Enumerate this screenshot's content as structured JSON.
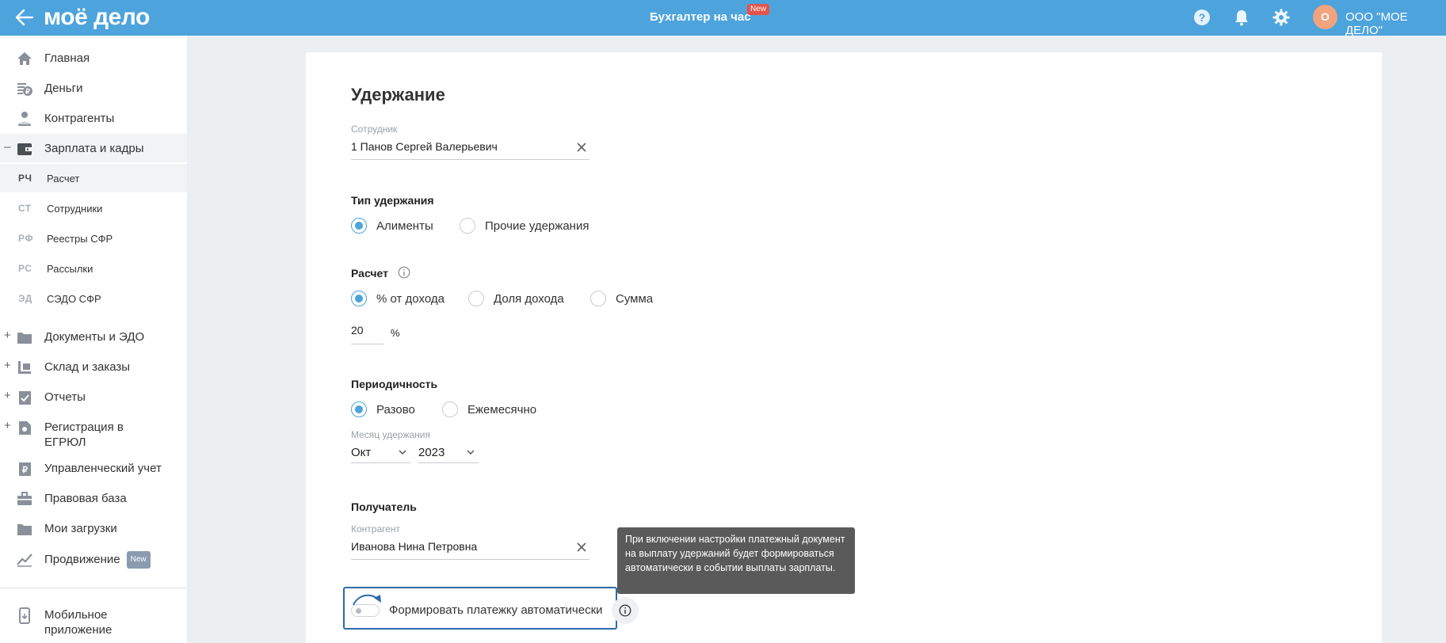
{
  "topbar": {
    "logo": "моё дело",
    "center_title": "Бухгалтер на час",
    "center_badge": "New",
    "avatar_initial": "О",
    "org_name": "ООО \"МОЕ ДЕЛО\"",
    "icons": [
      "back-arrow-icon",
      "help-icon",
      "bell-icon",
      "gear-icon"
    ],
    "accent_color": "#4da3dc"
  },
  "sidebar": {
    "items": [
      {
        "label": "Главная",
        "icon": "home-icon"
      },
      {
        "label": "Деньги",
        "icon": "money-icon"
      },
      {
        "label": "Контрагенты",
        "icon": "contractors-icon"
      },
      {
        "label": "Зарплата и кадры",
        "icon": "wallet-icon",
        "expanded_mark": "–"
      }
    ],
    "sub_items": [
      {
        "abbr": "РЧ",
        "label": "Расчет"
      },
      {
        "abbr": "СТ",
        "label": "Сотрудники"
      },
      {
        "abbr": "РФ",
        "label": "Реестры СФР"
      },
      {
        "abbr": "РС",
        "label": "Рассылки"
      },
      {
        "abbr": "ЭД",
        "label": "СЭДО СФР"
      }
    ],
    "items2": [
      {
        "label": "Документы и ЭДО",
        "icon": "folder-icon",
        "mark": "+"
      },
      {
        "label": "Склад и заказы",
        "icon": "warehouse-icon",
        "mark": "+"
      },
      {
        "label": "Отчеты",
        "icon": "reports-icon",
        "mark": "+"
      },
      {
        "label": "Регистрация в",
        "label2": "ЕГРЮЛ",
        "icon": "registration-icon",
        "mark": "+"
      },
      {
        "label": "Управленческий учет",
        "icon": "ruble-doc-icon"
      },
      {
        "label": "Правовая база",
        "icon": "briefcase-icon"
      },
      {
        "label": "Мои загрузки",
        "icon": "folder-icon"
      },
      {
        "label": "Продвижение",
        "icon": "chart-icon",
        "badge": "New"
      }
    ],
    "mobile": {
      "label": "Мобильное",
      "label2": "приложение",
      "icon": "mobile-icon"
    }
  },
  "form": {
    "title": "Удержание",
    "employee": {
      "label": "Сотрудник",
      "value": "1 Панов Сергей Валерьевич"
    },
    "type": {
      "title": "Тип удержания",
      "options": [
        "Алименты",
        "Прочие удержания"
      ],
      "selected": "Алименты"
    },
    "calc": {
      "title": "Расчет",
      "options": [
        "% от дохода",
        "Доля дохода",
        "Сумма"
      ],
      "selected": "% от дохода",
      "value": "20",
      "unit": "%"
    },
    "period": {
      "title": "Периодичность",
      "options": [
        "Разово",
        "Ежемесячно"
      ],
      "selected": "Разово",
      "month_label": "Месяц удержания",
      "month": "Окт",
      "year": "2023"
    },
    "recipient": {
      "title": "Получатель",
      "label": "Контрагент",
      "value": "Иванова Нина Петровна"
    },
    "auto_payment": {
      "label": "Формировать платежку автоматически",
      "enabled": false,
      "tooltip": "При включении настройки платежный документ на выплату удержаний будет формироваться автоматически в событии выплаты зарплаты."
    }
  }
}
